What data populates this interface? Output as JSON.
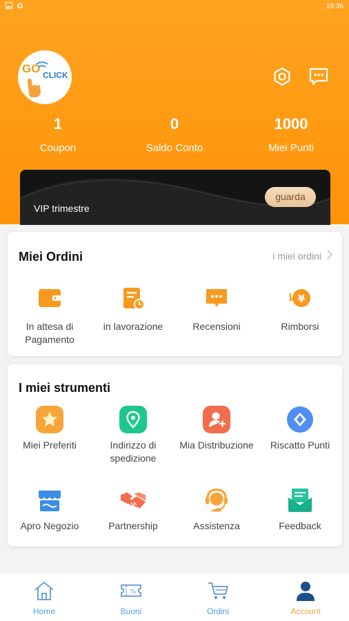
{
  "status_bar": {
    "time": "19:36",
    "left_icons": [
      "image-icon",
      "google-icon"
    ]
  },
  "header": {
    "logo": {
      "text_go": "GO",
      "text_click": "CLICK"
    },
    "icons": [
      "settings-icon",
      "message-icon"
    ],
    "stats": [
      {
        "value": "1",
        "label": "Coupon"
      },
      {
        "value": "0",
        "label": "Saldo Conto"
      },
      {
        "value": "1000",
        "label": "Miei Punti"
      }
    ],
    "vip": {
      "title": "VIP trimestre",
      "button": "guarda"
    }
  },
  "orders": {
    "title": "Miei Ordini",
    "link": "i miei ordini",
    "items": [
      {
        "label": "In attesa di Pagamento",
        "icon": "wallet-icon"
      },
      {
        "label": "in lavorazione",
        "icon": "processing-icon"
      },
      {
        "label": "Recensioni",
        "icon": "review-icon"
      },
      {
        "label": "Rimborsi",
        "icon": "refund-icon"
      }
    ]
  },
  "tools": {
    "title": "I miei strumenti",
    "items": [
      {
        "label": "Miei Preferiti",
        "icon": "star-icon"
      },
      {
        "label": "Indirizzo di spedizione",
        "icon": "location-icon"
      },
      {
        "label": "Mia Distribuzione",
        "icon": "distribution-icon"
      },
      {
        "label": "Riscatto Punti",
        "icon": "points-icon"
      },
      {
        "label": "Apro Negozio",
        "icon": "shop-icon"
      },
      {
        "label": "Partnership",
        "icon": "handshake-icon"
      },
      {
        "label": "Assistenza",
        "icon": "support-icon"
      },
      {
        "label": "Feedback",
        "icon": "feedback-icon"
      }
    ]
  },
  "tabbar": {
    "tabs": [
      {
        "label": "Home",
        "icon": "home-icon"
      },
      {
        "label": "Buoni",
        "icon": "coupon-icon"
      },
      {
        "label": "Ordini",
        "icon": "cart-icon"
      },
      {
        "label": "Account",
        "icon": "account-icon"
      }
    ],
    "active": "Account"
  },
  "colors": {
    "primary_orange": "#ff9a12",
    "link_blue": "#4aa3e6",
    "active_tab": "#f7a23c",
    "vip_bg": "#141414"
  }
}
